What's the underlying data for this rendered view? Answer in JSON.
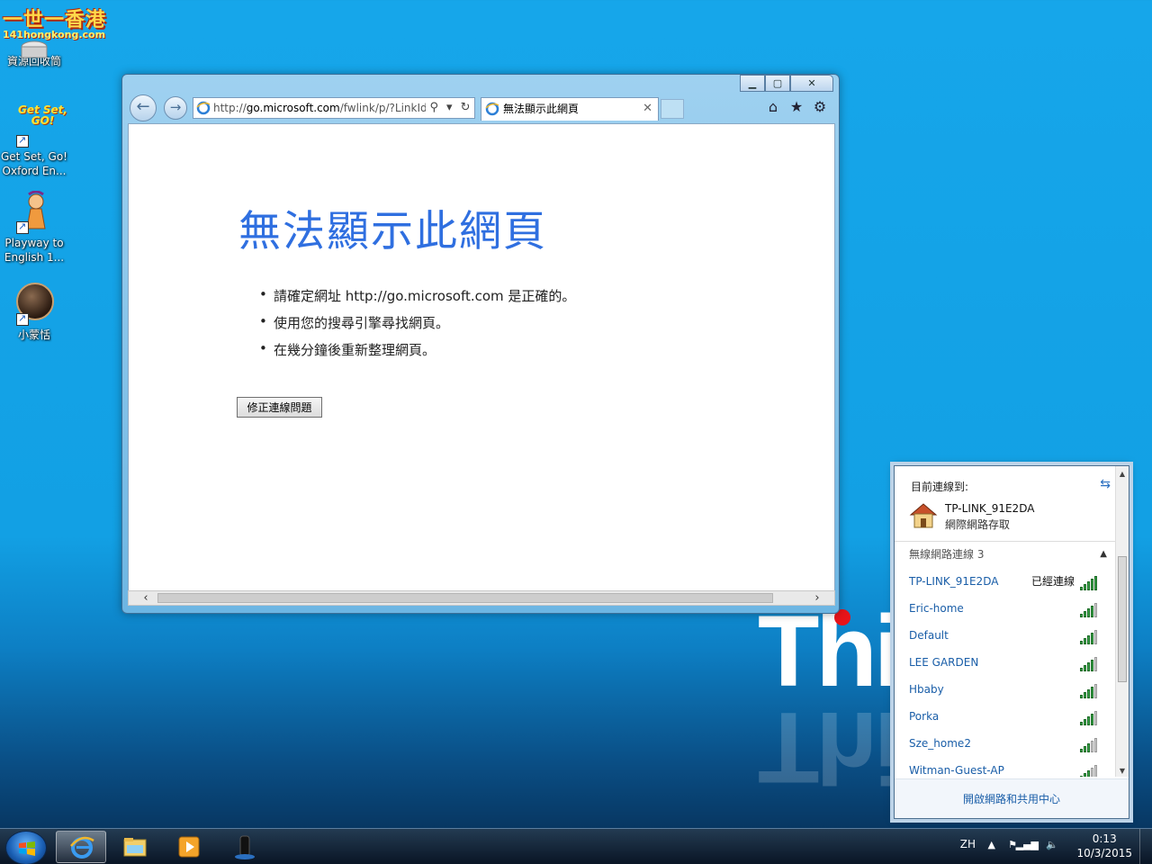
{
  "desktop": {
    "logo_text": "一世一香港",
    "logo_sub": "141hongkong.com",
    "icons": [
      {
        "label": "資源回收筒"
      },
      {
        "label": "Get Set, Go!\nOxford En..."
      },
      {
        "label": "Playway to\nEnglish 1..."
      },
      {
        "label": "小蒙恬"
      }
    ],
    "getset_icon_text": "Get Set,\nGO!",
    "watermark": "Thin"
  },
  "browser": {
    "address_prefix": "http://",
    "address_host": "go.microsoft.com",
    "address_rest": "/fwlink/p/?LinkId=",
    "tab_title": "無法顯示此網頁",
    "page": {
      "title": "無法顯示此網頁",
      "bullets": [
        "請確定網址 http://go.microsoft.com 是正確的。",
        "使用您的搜尋引擎尋找網頁。",
        "在幾分鐘後重新整理網頁。"
      ],
      "fix_button": "修正連線問題"
    }
  },
  "network_flyout": {
    "connected_label": "目前連線到:",
    "current_network": "TP-LINK_91E2DA",
    "access_type": "網際網路存取",
    "section_label": "無線網路連線 3",
    "networks": [
      {
        "name": "TP-LINK_91E2DA",
        "status": "已經連線",
        "signal": 5
      },
      {
        "name": "Eric-home",
        "status": "",
        "signal": 4
      },
      {
        "name": "Default",
        "status": "",
        "signal": 4
      },
      {
        "name": "LEE GARDEN",
        "status": "",
        "signal": 4
      },
      {
        "name": "Hbaby",
        "status": "",
        "signal": 4
      },
      {
        "name": "Porka",
        "status": "",
        "signal": 4
      },
      {
        "name": "Sze_home2",
        "status": "",
        "signal": 3
      },
      {
        "name": "Witman-Guest-AP",
        "status": "",
        "signal": 3
      }
    ],
    "footer_link": "開啟網路和共用中心"
  },
  "taskbar": {
    "language": "ZH",
    "time": "0:13",
    "date": "10/3/2015"
  },
  "colors": {
    "accent_blue": "#2f6fe0",
    "link_blue": "#1a5ea8",
    "signal_green": "#39a84a",
    "red_dot": "#e8141a"
  }
}
